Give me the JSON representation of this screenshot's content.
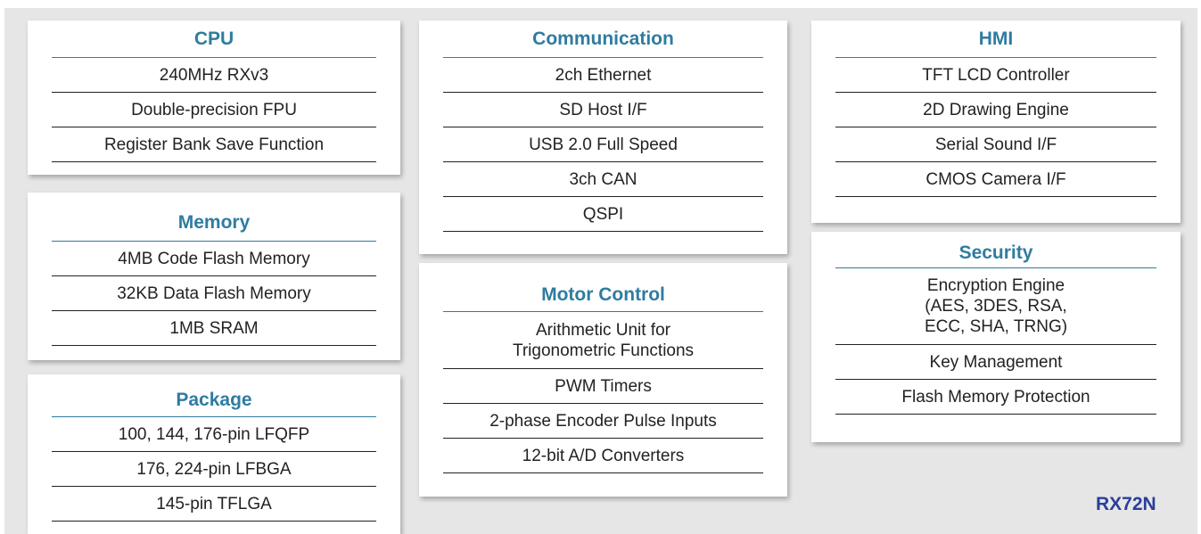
{
  "blocks": {
    "cpu": {
      "title": "CPU",
      "items": [
        "240MHz RXv3",
        "Double-precision FPU",
        "Register Bank Save Function"
      ]
    },
    "memory": {
      "title": "Memory",
      "items": [
        "4MB Code Flash Memory",
        "32KB Data Flash Memory",
        "1MB SRAM"
      ]
    },
    "package": {
      "title": "Package",
      "items": [
        "100, 144, 176-pin LFQFP",
        "176, 224-pin LFBGA",
        "145-pin TFLGA"
      ]
    },
    "communication": {
      "title": "Communication",
      "items": [
        "2ch Ethernet",
        "SD Host I/F",
        "USB 2.0 Full Speed",
        "3ch CAN",
        "QSPI"
      ]
    },
    "motor": {
      "title": "Motor Control",
      "items": [
        "Arithmetic Unit for Trigonometric Functions",
        "PWM Timers",
        "2-phase Encoder Pulse Inputs",
        "12-bit A/D Converters"
      ]
    },
    "hmi": {
      "title": "HMI",
      "items": [
        "TFT LCD Controller",
        "2D Drawing Engine",
        "Serial Sound I/F",
        "CMOS Camera I/F"
      ]
    },
    "security": {
      "title": "Security",
      "items": [
        "Encryption Engine (AES, 3DES, RSA, ECC, SHA, TRNG)",
        "Key Management",
        "Flash Memory Protection"
      ]
    }
  },
  "brand": "RX72N",
  "colors": {
    "title": "#2f7ca0",
    "brand": "#2a3f99",
    "background": "#e6e6e6"
  }
}
